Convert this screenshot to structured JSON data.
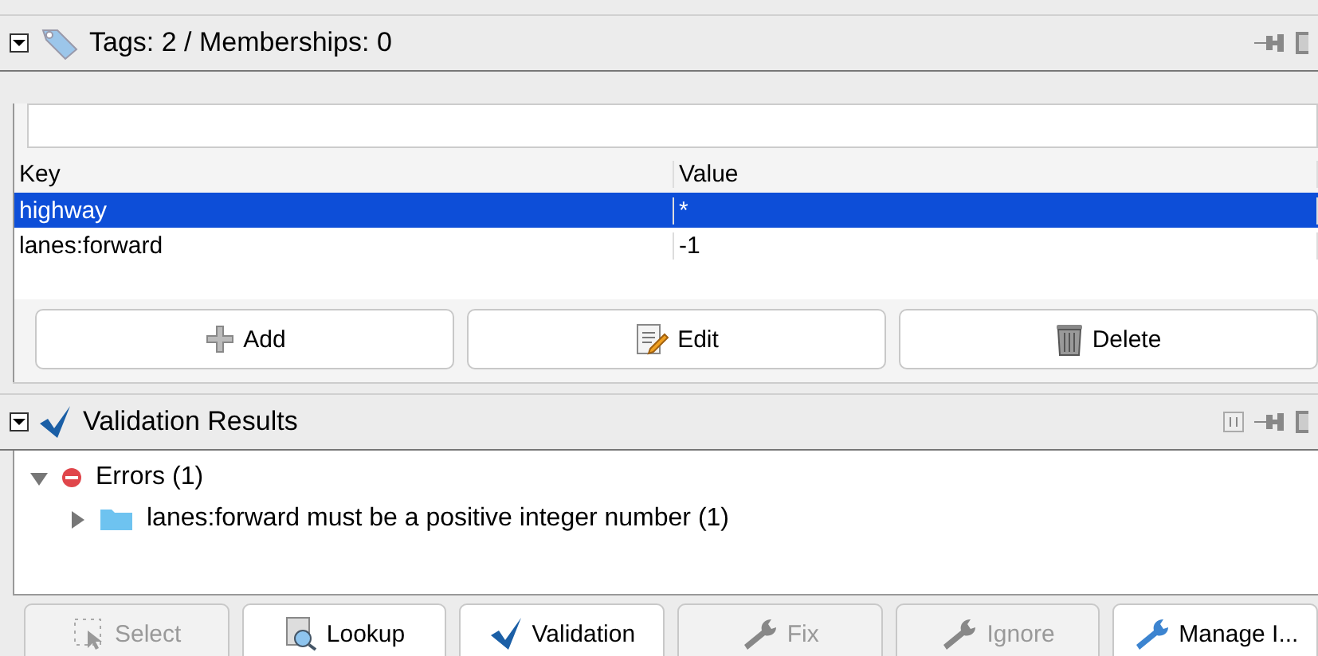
{
  "tags_panel": {
    "title": "Tags: 2 / Memberships: 0",
    "expanded": true,
    "table": {
      "columns": [
        "Key",
        "Value"
      ],
      "rows": [
        {
          "key": "highway",
          "value": "*",
          "selected": true
        },
        {
          "key": "lanes:forward",
          "value": "-1",
          "selected": false
        }
      ]
    },
    "buttons": [
      {
        "label": "Add"
      },
      {
        "label": "Edit"
      },
      {
        "label": "Delete"
      }
    ]
  },
  "validation_panel": {
    "title": "Validation Results",
    "expanded": true,
    "tree": [
      {
        "label": "Errors (1)",
        "expanded": true,
        "children": [
          {
            "label": "lanes:forward must be a positive integer number (1)",
            "expanded": false
          }
        ]
      }
    ],
    "buttons": [
      {
        "label": "Select",
        "disabled": true
      },
      {
        "label": "Lookup",
        "disabled": false
      },
      {
        "label": "Validation",
        "disabled": false
      },
      {
        "label": "Fix",
        "disabled": true
      },
      {
        "label": "Ignore",
        "disabled": true
      },
      {
        "label": "Manage I...",
        "disabled": false
      }
    ]
  }
}
